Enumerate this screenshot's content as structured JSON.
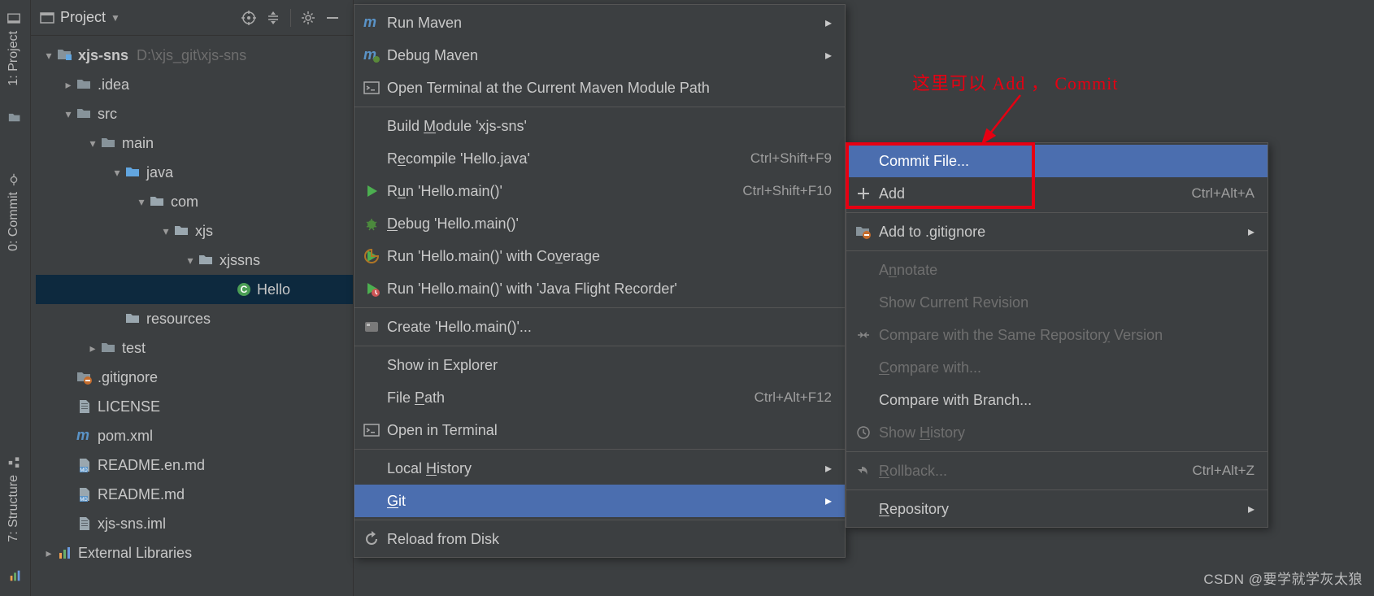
{
  "leftTabs": {
    "project": "1: Project",
    "commit": "0: Commit",
    "structure": "7: Structure"
  },
  "paneHeader": {
    "title": "Project"
  },
  "tree": {
    "root": {
      "name": "xjs-sns",
      "path": "D:\\xjs_git\\xjs-sns"
    },
    "idea": ".idea",
    "src": "src",
    "main": "main",
    "java": "java",
    "com": "com",
    "xjs": "xjs",
    "xjssns": "xjssns",
    "hello": "Hello",
    "resources": "resources",
    "test": "test",
    "gitignore": ".gitignore",
    "license": "LICENSE",
    "pom": "pom.xml",
    "readmeEn": "README.en.md",
    "readme": "README.md",
    "iml": "xjs-sns.iml",
    "extlib": "External Libraries"
  },
  "menu1": {
    "runMaven": "Run Maven",
    "debugMaven": "Debug Maven",
    "openTerminal": "Open Terminal at the Current Maven Module Path",
    "buildModule": "Build Module 'xjs-sns'",
    "recompile": "Recompile 'Hello.java'",
    "recompileSC": "Ctrl+Shift+F9",
    "run": "Run 'Hello.main()'",
    "runSC": "Ctrl+Shift+F10",
    "debug": "Debug 'Hello.main()'",
    "cov": "Run 'Hello.main()' with Coverage",
    "jfr": "Run 'Hello.main()' with 'Java Flight Recorder'",
    "create": "Create 'Hello.main()'...",
    "explorer": "Show in Explorer",
    "filePath": "File Path",
    "filePathSC": "Ctrl+Alt+F12",
    "openTerm": "Open in Terminal",
    "localHist": "Local History",
    "git": "Git",
    "reload": "Reload from Disk"
  },
  "menu2": {
    "commitFile": "Commit File...",
    "add": "Add",
    "addSC": "Ctrl+Alt+A",
    "addIgnore": "Add to .gitignore",
    "annotate": "Annotate",
    "showRev": "Show Current Revision",
    "cmpSame": "Compare with the Same Repository Version",
    "cmpWith": "Compare with...",
    "cmpBranch": "Compare with Branch...",
    "showHist": "Show History",
    "rollback": "Rollback...",
    "rollbackSC": "Ctrl+Alt+Z",
    "repository": "Repository"
  },
  "annotation": "这里可以 Add ， Commit",
  "watermark": "CSDN @要学就学灰太狼"
}
